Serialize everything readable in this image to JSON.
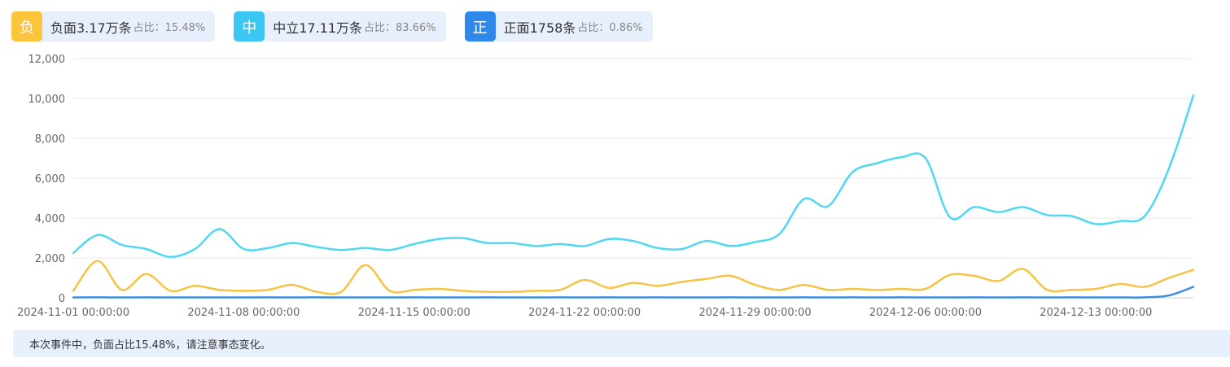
{
  "legend": [
    {
      "badge": "负",
      "label": "负面3.17万条",
      "ratio": "占比：15.48%",
      "color": "#fbc53b"
    },
    {
      "badge": "中",
      "label": "中立17.11万条",
      "ratio": "占比：83.66%",
      "color": "#3cc6f2"
    },
    {
      "badge": "正",
      "label": "正面1758条",
      "ratio": "占比：0.86%",
      "color": "#2e88ea"
    }
  ],
  "note": "本次事件中，负面占比15.48%，请注意事态变化。",
  "chart_data": {
    "type": "line",
    "ylim": [
      0,
      12000
    ],
    "yticks": [
      "0",
      "2,000",
      "4,000",
      "6,000",
      "8,000",
      "10,000",
      "12,000"
    ],
    "xticks": [
      {
        "index": 0,
        "label": "2024-11-01 00:00:00"
      },
      {
        "index": 7,
        "label": "2024-11-08 00:00:00"
      },
      {
        "index": 14,
        "label": "2024-11-15 00:00:00"
      },
      {
        "index": 21,
        "label": "2024-11-22 00:00:00"
      },
      {
        "index": 28,
        "label": "2024-11-29 00:00:00"
      },
      {
        "index": 35,
        "label": "2024-12-06 00:00:00"
      },
      {
        "index": 42,
        "label": "2024-12-13 00:00:00"
      }
    ],
    "x": [
      "2024-11-01",
      "2024-11-02",
      "2024-11-03",
      "2024-11-04",
      "2024-11-05",
      "2024-11-06",
      "2024-11-07",
      "2024-11-08",
      "2024-11-09",
      "2024-11-10",
      "2024-11-11",
      "2024-11-12",
      "2024-11-13",
      "2024-11-14",
      "2024-11-15",
      "2024-11-16",
      "2024-11-17",
      "2024-11-18",
      "2024-11-19",
      "2024-11-20",
      "2024-11-21",
      "2024-11-22",
      "2024-11-23",
      "2024-11-24",
      "2024-11-25",
      "2024-11-26",
      "2024-11-27",
      "2024-11-28",
      "2024-11-29",
      "2024-11-30",
      "2024-12-01",
      "2024-12-02",
      "2024-12-03",
      "2024-12-04",
      "2024-12-05",
      "2024-12-06",
      "2024-12-07",
      "2024-12-08",
      "2024-12-09",
      "2024-12-10",
      "2024-12-11",
      "2024-12-12",
      "2024-12-13",
      "2024-12-14",
      "2024-12-15",
      "2024-12-16",
      "2024-12-17"
    ],
    "series": [
      {
        "name": "中立",
        "color": "#4fd8f0",
        "values": [
          2250,
          3150,
          2650,
          2450,
          2050,
          2450,
          3450,
          2450,
          2500,
          2750,
          2550,
          2400,
          2500,
          2400,
          2700,
          2950,
          3000,
          2750,
          2750,
          2600,
          2700,
          2600,
          2950,
          2850,
          2500,
          2450,
          2850,
          2600,
          2800,
          3200,
          4950,
          4600,
          6300,
          6750,
          7050,
          7000,
          4050,
          4550,
          4300,
          4550,
          4150,
          4100,
          3700,
          3850,
          4100,
          6500,
          10150
        ]
      },
      {
        "name": "负面",
        "color": "#f7c245",
        "values": [
          350,
          1850,
          400,
          1200,
          350,
          600,
          400,
          350,
          400,
          650,
          300,
          300,
          1650,
          350,
          400,
          450,
          350,
          300,
          300,
          350,
          400,
          900,
          500,
          750,
          600,
          800,
          950,
          1100,
          650,
          400,
          650,
          400,
          450,
          400,
          450,
          450,
          1150,
          1100,
          850,
          1450,
          400,
          400,
          450,
          700,
          550,
          1000,
          1400
        ]
      },
      {
        "name": "正面",
        "color": "#3b8ddf",
        "values": [
          20,
          25,
          20,
          25,
          20,
          20,
          20,
          20,
          25,
          20,
          25,
          20,
          20,
          20,
          25,
          20,
          20,
          25,
          20,
          20,
          25,
          20,
          25,
          20,
          25,
          20,
          20,
          25,
          20,
          20,
          25,
          20,
          25,
          20,
          25,
          20,
          20,
          25,
          20,
          25,
          20,
          25,
          20,
          20,
          25,
          120,
          550
        ]
      }
    ]
  }
}
